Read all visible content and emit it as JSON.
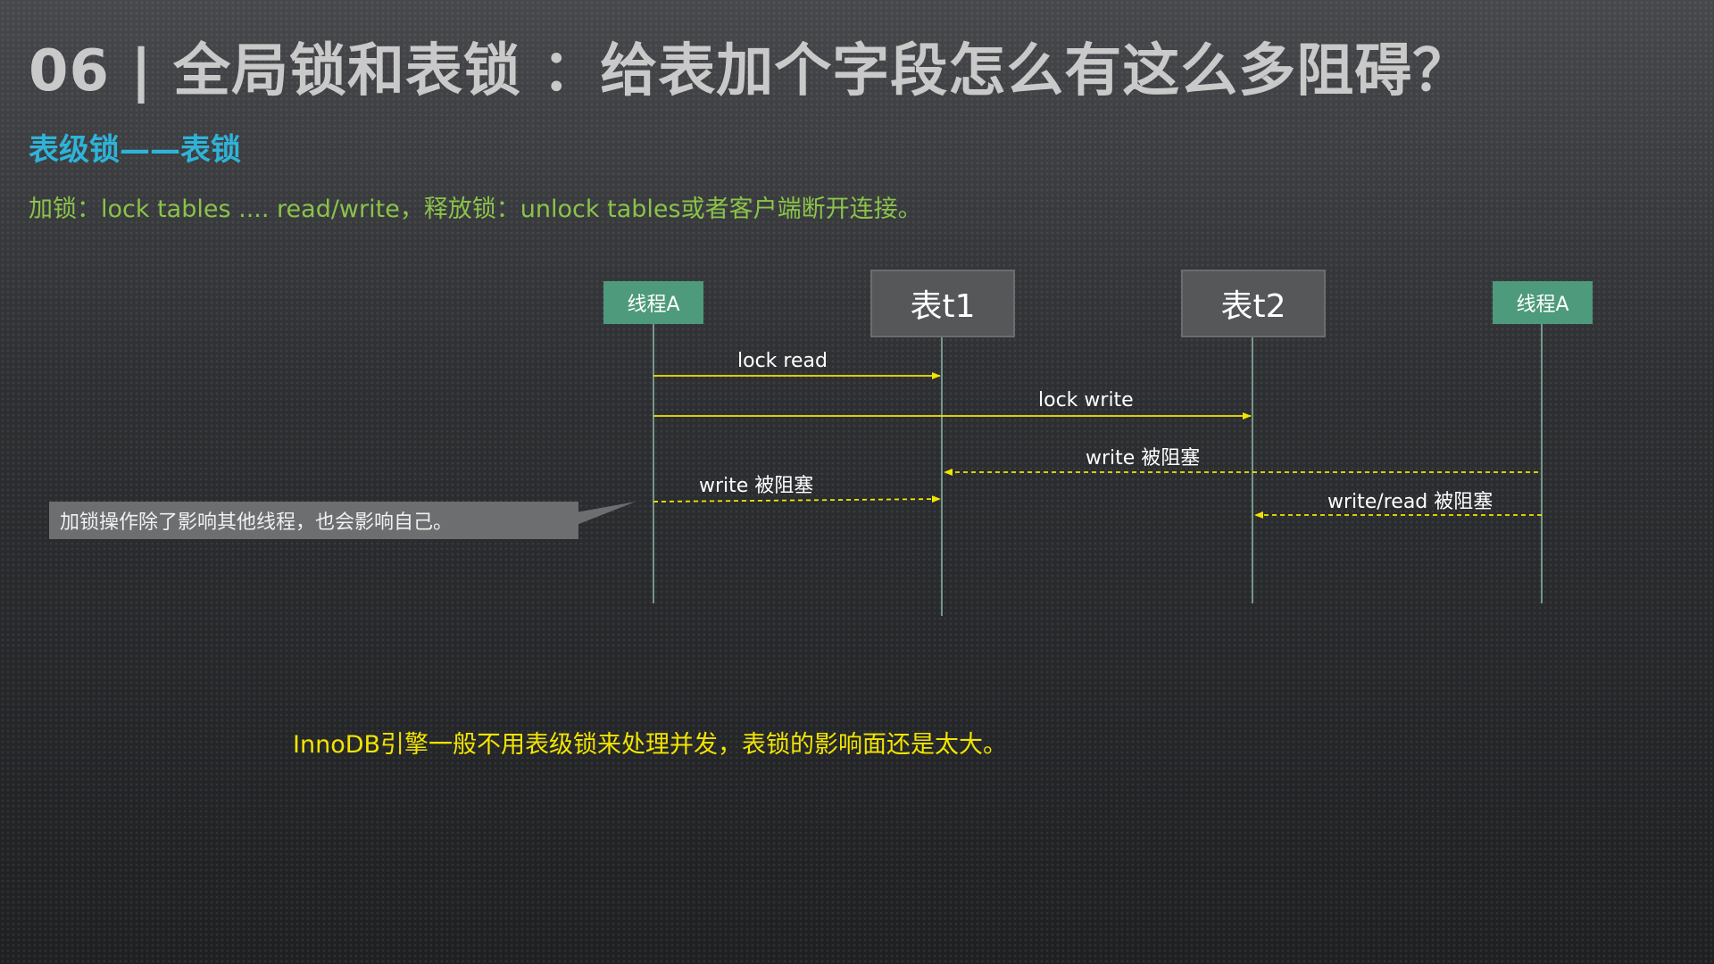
{
  "title": "06 | 全局锁和表锁 ：给表加个字段怎么有这么多阻碍？",
  "subtitle": "表级锁——表锁",
  "description": "加锁：lock tables .... read/write，释放锁：unlock tables或者客户端断开连接。",
  "participants": {
    "thread_left": "线程A",
    "table_t1": "表t1",
    "table_t2": "表t2",
    "thread_right": "线程A"
  },
  "messages": {
    "lock_read": "lock read",
    "lock_write": "lock write",
    "write_blocked_right": "write 被阻塞",
    "write_blocked_left": "write 被阻塞",
    "write_read_blocked": "write/read 被阻塞"
  },
  "note": "加锁操作除了影响其他线程，也会影响自己。",
  "footer": "InnoDB引擎一般不用表级锁来处理并发，表锁的影响面还是太大。",
  "colors": {
    "title": "#c9c9c9",
    "subtitle": "#2fb3d8",
    "description": "#8bc34a",
    "footer": "#f2e400",
    "thread_box": "#4e9a7c",
    "table_box": "#555758",
    "arrow": "#f2e400",
    "lifeline": "#8fb9a8"
  }
}
